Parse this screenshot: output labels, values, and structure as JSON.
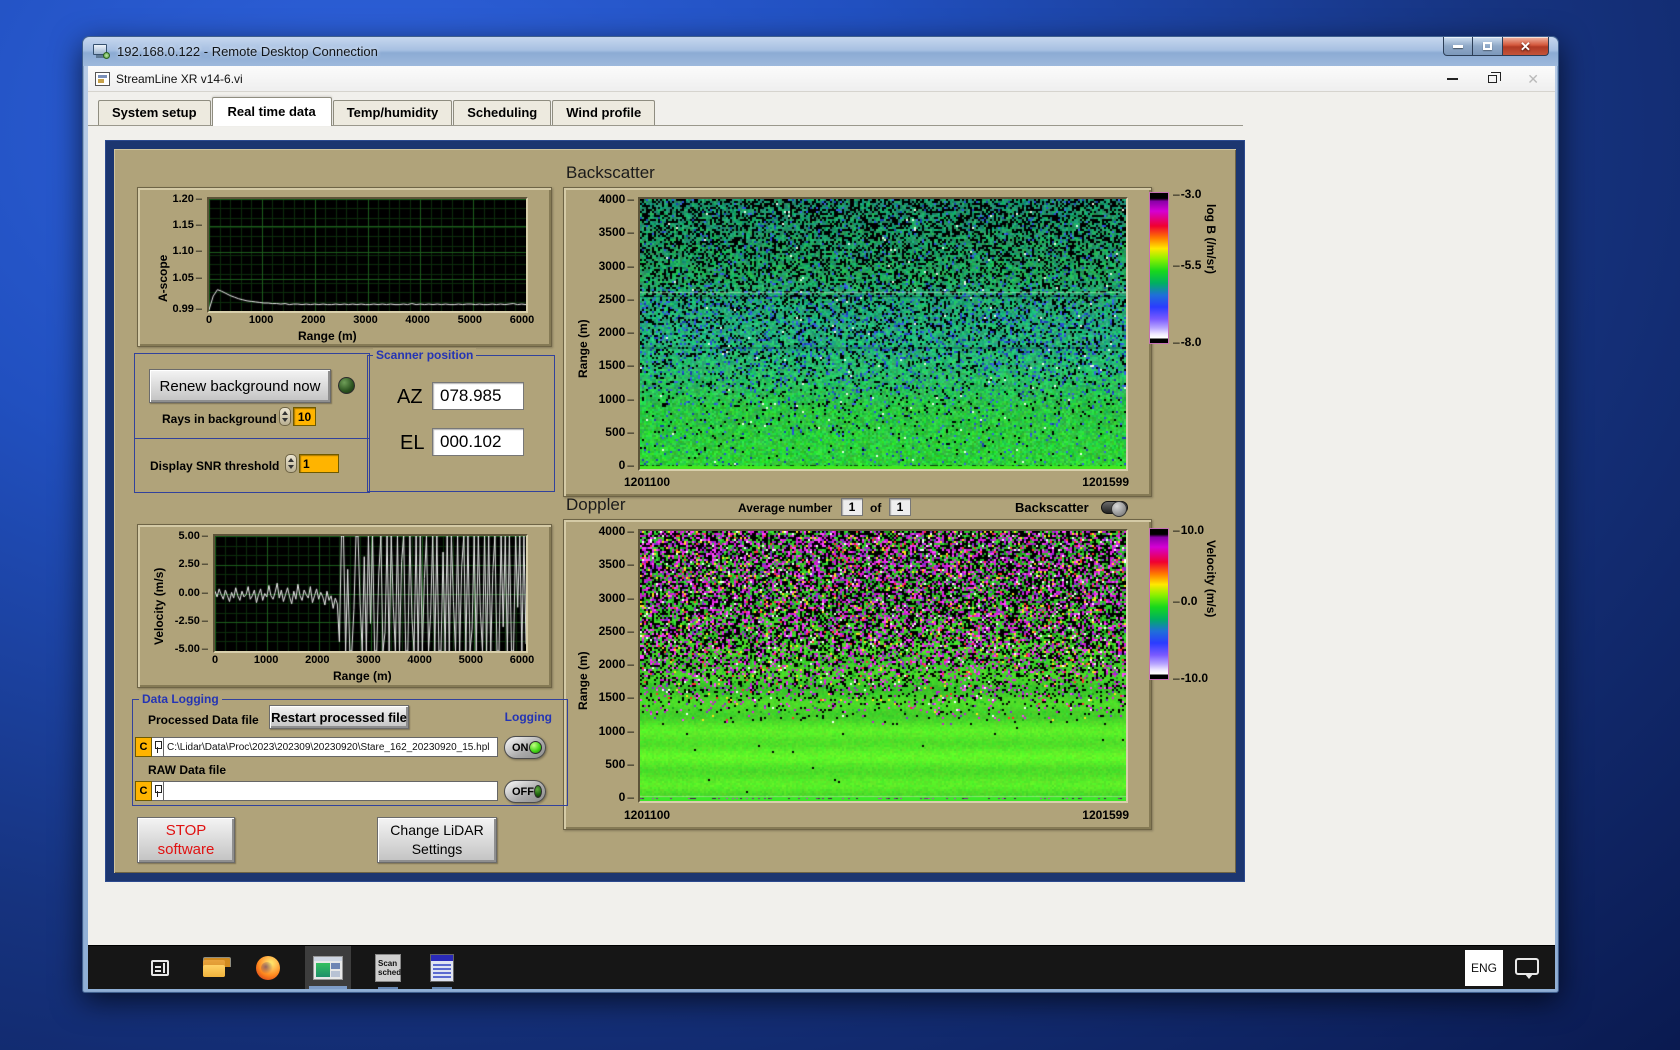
{
  "rdp": {
    "title": "192.168.0.122 - Remote Desktop Connection"
  },
  "app": {
    "title": "StreamLine XR v14-6.vi"
  },
  "tabs": [
    {
      "label": "System setup"
    },
    {
      "label": "Real time data"
    },
    {
      "label": "Temp/humidity"
    },
    {
      "label": "Scheduling"
    },
    {
      "label": "Wind profile"
    }
  ],
  "ascope": {
    "ylabel": "A-scope",
    "xlabel": "Range (m)",
    "yticks": [
      "1.20",
      "1.15",
      "1.10",
      "1.05",
      "0.99"
    ],
    "xticks": [
      "0",
      "1000",
      "2000",
      "3000",
      "4000",
      "5000",
      "6000"
    ]
  },
  "controls": {
    "renew_button": "Renew background now",
    "rays_label": "Rays in background",
    "rays_value": "10",
    "snr_label": "Display SNR threshold",
    "snr_value": "1",
    "scanner_title": "Scanner position",
    "az_label": "AZ",
    "az_value": "078.985",
    "el_label": "EL",
    "el_value": "000.102"
  },
  "backscatter": {
    "title": "Backscatter",
    "ylabel": "Range (m)",
    "yticks": [
      "4000",
      "3500",
      "3000",
      "2500",
      "2000",
      "1500",
      "1000",
      "500",
      "0"
    ],
    "x_left": "1201100",
    "x_right": "1201599",
    "cb_ticks": [
      "-3.0",
      "-5.5",
      "-8.0"
    ],
    "cb_label": "log B (/m/sr)"
  },
  "doppler": {
    "title": "Doppler",
    "avg_label": "Average number",
    "avg_a": "1",
    "of_label": "of",
    "avg_b": "1",
    "toggle_label": "Backscatter",
    "ylabel": "Range (m)",
    "yticks": [
      "4000",
      "3500",
      "3000",
      "2500",
      "2000",
      "1500",
      "1000",
      "500",
      "0"
    ],
    "x_left": "1201100",
    "x_right": "1201599",
    "cb_ticks": [
      "10.0",
      "0.0",
      "-10.0"
    ],
    "cb_label": "Velocity (m/s)"
  },
  "velocity": {
    "ylabel": "Velocity (m/s)",
    "xlabel": "Range (m)",
    "yticks": [
      "5.00",
      "2.50",
      "0.00",
      "-2.50",
      "-5.00"
    ],
    "xticks": [
      "0",
      "1000",
      "2000",
      "3000",
      "4000",
      "5000",
      "6000"
    ]
  },
  "logging": {
    "group_label": "Data Logging",
    "processed_label": "Processed Data file",
    "restart_button": "Restart processed file",
    "logging_label": "Logging",
    "drive_a": "C",
    "processed_path": "C:\\Lidar\\Data\\Proc\\2023\\202309\\20230920\\Stare_162_20230920_15.hpl",
    "on_label": "ON",
    "raw_label": "RAW Data file",
    "drive_b": "C",
    "raw_path": "",
    "off_label": "OFF"
  },
  "footer": {
    "stop_l1": "STOP",
    "stop_l2": "software",
    "change_l1": "Change LiDAR",
    "change_l2": "Settings"
  },
  "taskbar": {
    "eng": "ENG",
    "scan_l1": "Scan",
    "scan_l2": "sched"
  },
  "chart_data": [
    {
      "name": "ascope",
      "type": "line",
      "title": "A-scope",
      "xlabel": "Range (m)",
      "ylabel": "A-scope",
      "x_max": 6000,
      "dx": 80,
      "ylim": [
        0.99,
        1.2
      ],
      "yticks": [
        1.2,
        1.15,
        1.1,
        1.05,
        0.99
      ],
      "xticks": [
        0,
        1000,
        2000,
        3000,
        4000,
        5000,
        6000
      ],
      "values": [
        0.992,
        1.018,
        1.03,
        1.027,
        1.023,
        1.019,
        1.016,
        1.013,
        1.011,
        1.009,
        1.008,
        1.007,
        1.006,
        1.005,
        1.005,
        1.004,
        1.004,
        1.003,
        1.004,
        1.002,
        1.003,
        1.003,
        1.002,
        1.003,
        1.002,
        1.003,
        1.002,
        1.003,
        1.002,
        1.002,
        1.003,
        1.002,
        1.003,
        1.002,
        1.003,
        1.002,
        1.003,
        1.002,
        1.002,
        1.003,
        1.002,
        1.003,
        1.002,
        1.003,
        1.002,
        1.002,
        1.003,
        1.002,
        1.004,
        1.002,
        1.003,
        1.002,
        1.003,
        1.002,
        1.003,
        1.002,
        1.003,
        1.002,
        1.002,
        1.003,
        1.002,
        1.003,
        1.003,
        1.002,
        1.003,
        1.002,
        1.002,
        1.003,
        1.002,
        1.003,
        1.002,
        1.003,
        1.004,
        1.002,
        1.003,
        1.002
      ]
    },
    {
      "name": "velocity",
      "type": "line",
      "title": "Doppler velocity vs range",
      "xlabel": "Range (m)",
      "ylabel": "Velocity (m/s)",
      "x_max": 6000,
      "dx": 40,
      "ylim": [
        -5,
        5
      ],
      "yticks": [
        5.0,
        2.5,
        0.0,
        -2.5,
        -5.0
      ],
      "xticks": [
        0,
        1000,
        2000,
        3000,
        4000,
        5000,
        6000
      ],
      "values": [
        0.2,
        -0.3,
        0.4,
        -0.1,
        -0.5,
        0.3,
        -0.2,
        -0.7,
        0.1,
        -0.4,
        0.5,
        -0.2,
        -0.6,
        0.2,
        -0.3,
        -0.1,
        0.6,
        -0.5,
        -0.2,
        0.3,
        -0.8,
        -0.1,
        0.4,
        -0.6,
        0.0,
        -0.3,
        0.7,
        -0.2,
        -0.5,
        0.1,
        0.9,
        -0.4,
        0.3,
        -0.7,
        -0.1,
        0.5,
        -0.3,
        -0.9,
        0.2,
        -0.5,
        0.8,
        -0.2,
        -0.6,
        0.3,
        -0.1,
        -0.4,
        0.6,
        -0.8,
        -0.2,
        0.4,
        -0.5,
        0.1,
        -0.3,
        -1.0,
        0.2,
        -0.6,
        -0.2,
        -1.3,
        -0.4,
        -0.9,
        -4.2,
        5.0,
        5.0,
        -5.0,
        2.1,
        -5.0,
        -5.0,
        -1.4,
        5.0,
        5.0,
        -0.9,
        -5.0,
        3.2,
        -5.0,
        5.0,
        -2.6,
        5.0,
        -5.0,
        -5.0,
        1.7,
        5.0,
        -5.0,
        -3.4,
        5.0,
        -5.0,
        5.0,
        -1.1,
        -5.0,
        5.0,
        -5.0,
        2.8,
        5.0,
        -5.0,
        -5.0,
        5.0,
        -2.2,
        -5.0,
        5.0,
        -5.0,
        5.0,
        -5.0,
        1.3,
        5.0,
        -5.0,
        -1.8,
        5.0,
        -5.0,
        5.0,
        -5.0,
        -5.0,
        3.6,
        -5.0,
        5.0,
        -5.0,
        5.0,
        -0.7,
        -5.0,
        5.0,
        -5.0,
        2.4,
        5.0,
        -5.0,
        5.0,
        -5.0,
        -3.1,
        5.0,
        -5.0,
        5.0,
        -1.6,
        -5.0,
        5.0,
        -5.0,
        5.0,
        -5.0,
        1.9,
        5.0,
        -5.0,
        -5.0,
        5.0,
        -2.9,
        5.0,
        -5.0,
        5.0,
        -5.0,
        -5.0,
        5.0,
        -1.2,
        5.0,
        -5.0,
        5.0,
        -4.4
      ]
    },
    {
      "name": "backscatter",
      "type": "heatmap",
      "title": "Backscatter",
      "ylabel": "Range (m)",
      "ylim": [
        0,
        4000
      ],
      "x_left": 1201100,
      "x_right": 1201599,
      "colorbar": {
        "label": "log B (/m/sr)",
        "ticks": [
          -3.0,
          -5.5,
          -8.0
        ]
      },
      "description": "Speckled green backscatter noise with black and blue flecks aloft; smoother, brighter green below ~1000 m; bright lime surface return at 0 m."
    },
    {
      "name": "doppler",
      "type": "heatmap",
      "title": "Doppler",
      "ylabel": "Range (m)",
      "ylim": [
        0,
        4000
      ],
      "x_left": 1201100,
      "x_right": 1201599,
      "colorbar": {
        "label": "Velocity (m/s)",
        "ticks": [
          10.0,
          0.0,
          -10.0
        ]
      },
      "description": "Random magenta/black/green velocity noise above ~1800 m transitioning to smooth bright green banded flow near the ground."
    }
  ]
}
